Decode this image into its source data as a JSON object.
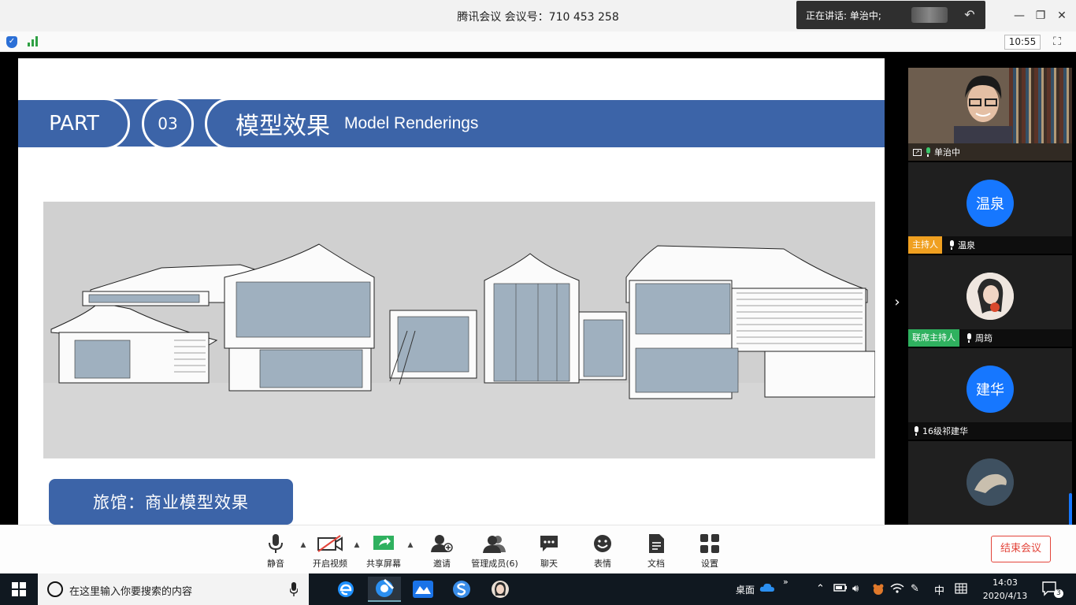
{
  "window": {
    "title": "腾讯会议 会议号：710 453 258",
    "speaking_text": "正在讲话: 单治中;",
    "meeting_time": "10:55"
  },
  "slide": {
    "part_label": "PART",
    "part_number": "03",
    "title_cn": "模型效果",
    "title_en": "Model Renderings",
    "caption": "旅馆：商业模型效果"
  },
  "participants": [
    {
      "name": "单治中",
      "type": "video",
      "role": "",
      "mic": "speaking"
    },
    {
      "name": "温泉",
      "type": "avatar",
      "avatar_text": "温泉",
      "role": "主持人",
      "mic": "on"
    },
    {
      "name": "周筠",
      "type": "photo",
      "role": "联席主持人",
      "mic": "on"
    },
    {
      "name": "16级祁建华",
      "type": "avatar",
      "avatar_text": "建华",
      "role": "",
      "mic": "muted"
    },
    {
      "name": "",
      "type": "photo",
      "role": "",
      "mic": "on"
    }
  ],
  "toolbar": {
    "mute": "静音",
    "video": "开启视频",
    "share": "共享屏幕",
    "invite": "邀请",
    "members": "管理成员(6)",
    "chat": "聊天",
    "emoji": "表情",
    "docs": "文档",
    "settings": "设置",
    "end": "结束会议"
  },
  "taskbar": {
    "search_placeholder": "在这里输入你要搜索的内容",
    "desktop_label": "桌面",
    "ime": "中",
    "time": "14:03",
    "date": "2020/4/13",
    "notification_count": "3"
  },
  "colors": {
    "slide_blue": "#3c64a8",
    "end_red": "#e3443a",
    "host_orange": "#f0a020",
    "cohost_green": "#2fb15f",
    "avatar_blue": "#1677ff"
  }
}
